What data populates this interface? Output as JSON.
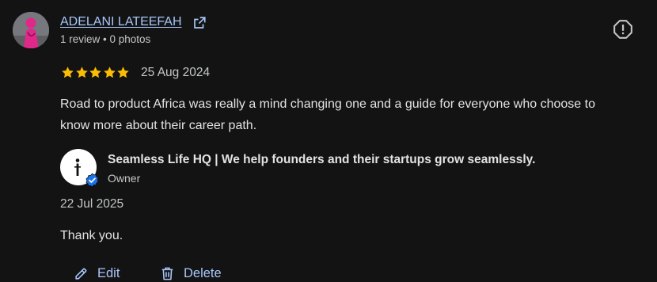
{
  "review": {
    "reviewer_name": "ADELANI LATEEFAH",
    "reviewer_meta": "1 review • 0 photos",
    "rating": 5,
    "rating_max": 5,
    "date": "25 Aug 2024",
    "text": "Road to product Africa was really a mind changing one and a guide for everyone who choose to know more about their career path."
  },
  "reply": {
    "owner_name": "Seamless Life HQ | We help founders and their startups grow seamlessly.",
    "owner_label": "Owner",
    "date": "22 Jul 2025",
    "text": "Thank you."
  },
  "actions": {
    "edit_label": "Edit",
    "delete_label": "Delete"
  },
  "icons": {
    "external_link": "external-link-icon",
    "report": "report-icon",
    "star": "star-icon",
    "verified": "verified-badge-icon",
    "edit": "pencil-icon",
    "delete": "trash-icon"
  },
  "colors": {
    "background": "#131314",
    "link": "#a8c7fa",
    "star": "#fbbc04",
    "verified": "#1a73e8"
  }
}
